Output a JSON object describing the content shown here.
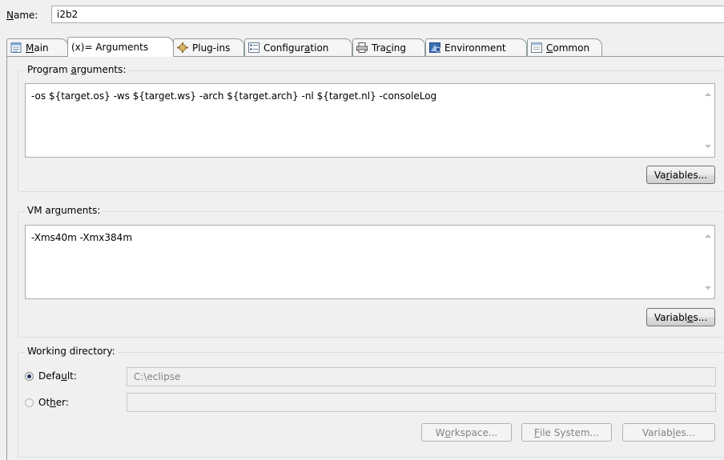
{
  "name": {
    "label": "Name:",
    "value": "i2b2"
  },
  "tabs": [
    {
      "label": "Main",
      "icon": "main-tab-icon",
      "active": false
    },
    {
      "label": "(x)= Arguments",
      "icon": "arguments-tab-icon",
      "active": true
    },
    {
      "label": "Plug-ins",
      "icon": "plugins-tab-icon",
      "active": false
    },
    {
      "label": "Configuration",
      "icon": "configuration-tab-icon",
      "active": false
    },
    {
      "label": "Tracing",
      "icon": "tracing-tab-icon",
      "active": false
    },
    {
      "label": "Environment",
      "icon": "environment-tab-icon",
      "active": false
    },
    {
      "label": "Common",
      "icon": "common-tab-icon",
      "active": false
    }
  ],
  "program_args": {
    "title": "Program arguments:",
    "value": "-os ${target.os} -ws ${target.ws} -arch ${target.arch} -nl ${target.nl} -consoleLog",
    "variables_button": "Variables..."
  },
  "vm_args": {
    "title": "VM arguments:",
    "value": "-Xms40m -Xmx384m",
    "variables_button": "Variables..."
  },
  "working_dir": {
    "title": "Working directory:",
    "default_label": "Default:",
    "default_value": "C:\\eclipse",
    "other_label": "Other:",
    "other_value": "",
    "workspace_button": "Workspace...",
    "filesystem_button": "File System...",
    "variables_button": "Variables..."
  }
}
